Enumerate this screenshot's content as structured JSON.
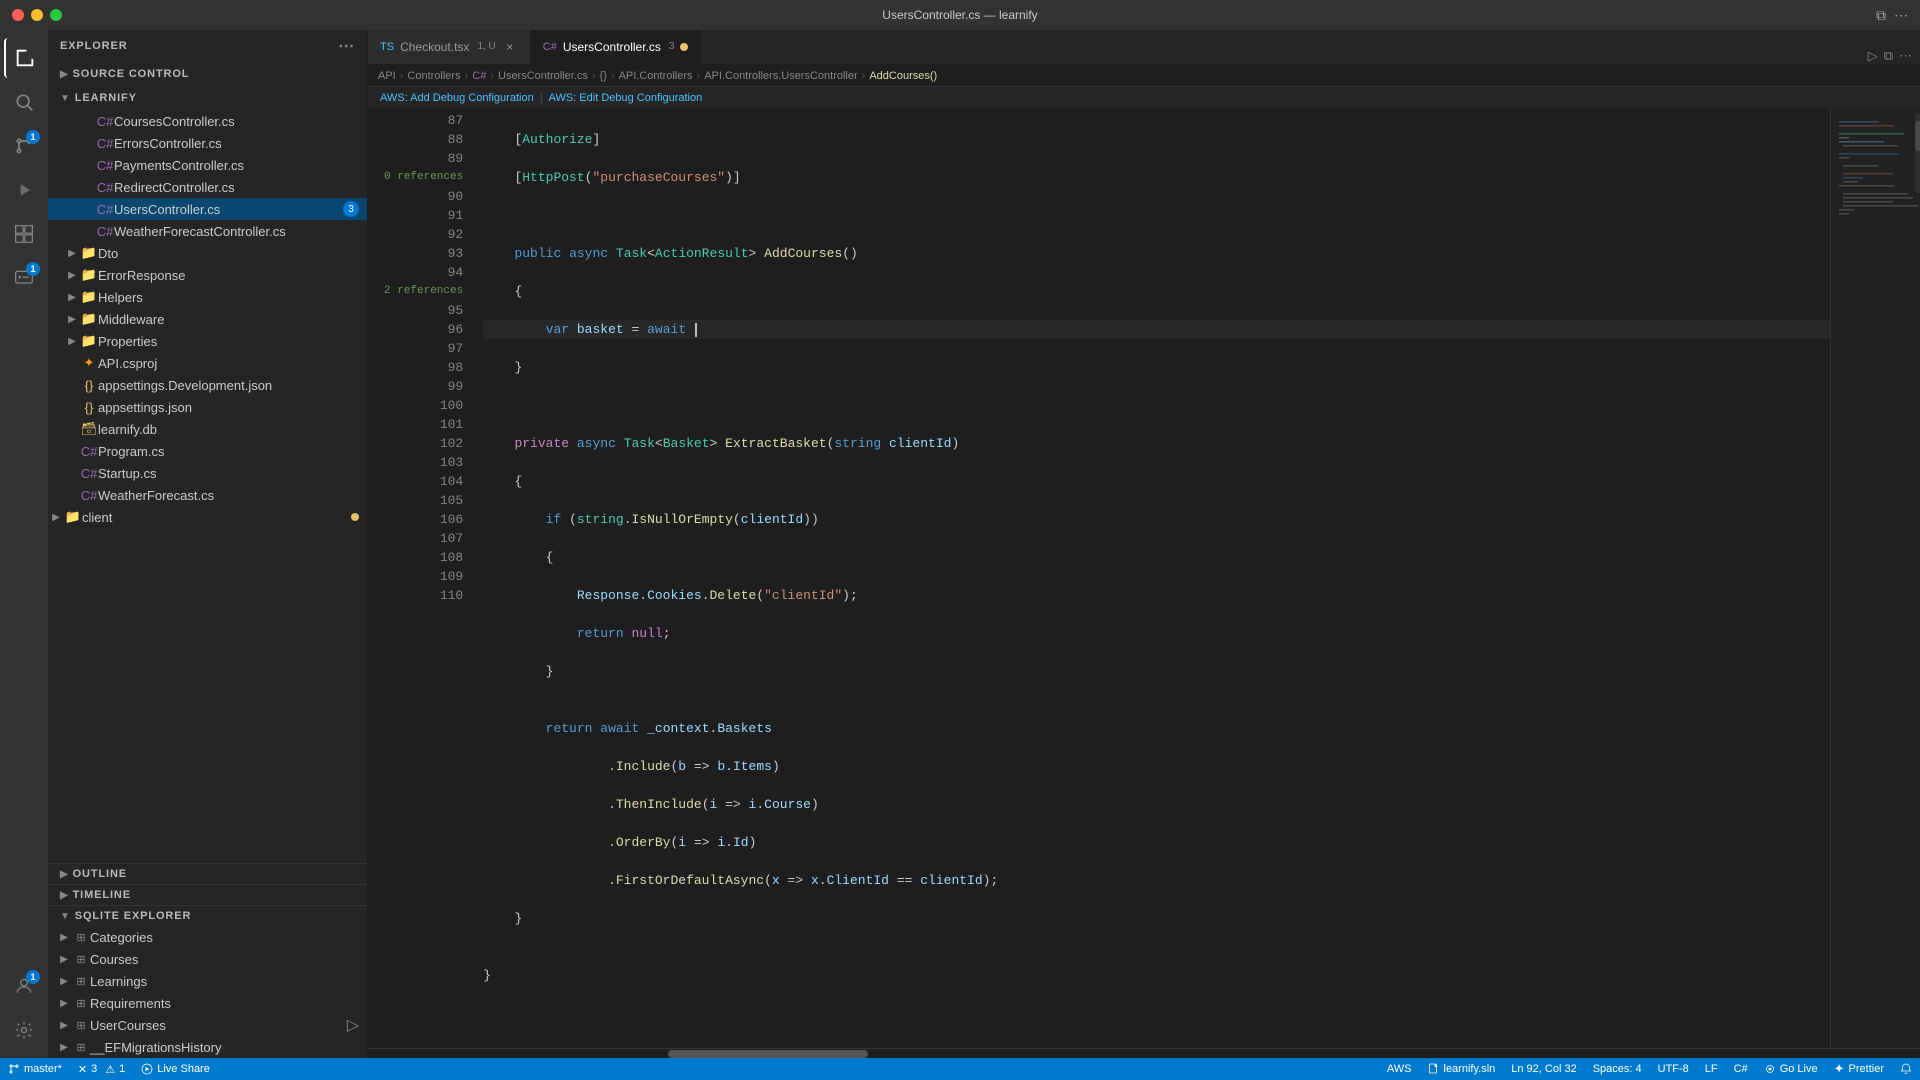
{
  "titleBar": {
    "title": "UsersController.cs — learnify",
    "trafficLights": [
      "red",
      "yellow",
      "green"
    ]
  },
  "tabs": [
    {
      "id": "checkout",
      "label": "Checkout.tsx",
      "badge": "1, U",
      "icon": "TS",
      "iconColor": "#4fc1ff",
      "active": false,
      "modified": false
    },
    {
      "id": "users",
      "label": "UsersController.cs",
      "badge": "3",
      "icon": "C#",
      "iconColor": "#9b6eaf",
      "active": true,
      "modified": true
    }
  ],
  "breadcrumb": {
    "items": [
      "API",
      "Controllers",
      "C#",
      "UsersController.cs",
      "{}",
      "API.Controllers",
      "API.Controllers.UsersController",
      "AddCourses()"
    ]
  },
  "awsBar": {
    "items": [
      "AWS: Add Debug Configuration",
      "AWS: Edit Debug Configuration"
    ]
  },
  "sidebar": {
    "explorerLabel": "EXPLORER",
    "sourceControlLabel": "SOURCE CONTROL",
    "projectName": "LEARNIFY",
    "files": [
      {
        "name": "CoursesController.cs",
        "type": "cs",
        "indent": 2
      },
      {
        "name": "ErrorsController.cs",
        "type": "cs",
        "indent": 2
      },
      {
        "name": "PaymentsController.cs",
        "type": "cs",
        "indent": 2
      },
      {
        "name": "RedirectController.cs",
        "type": "cs",
        "indent": 2
      },
      {
        "name": "UsersController.cs",
        "type": "cs",
        "indent": 2,
        "active": true,
        "badge": "3"
      },
      {
        "name": "WeatherForecastController.cs",
        "type": "cs",
        "indent": 2
      },
      {
        "name": "Dto",
        "type": "folder",
        "indent": 1
      },
      {
        "name": "ErrorResponse",
        "type": "folder",
        "indent": 1
      },
      {
        "name": "Helpers",
        "type": "folder",
        "indent": 1
      },
      {
        "name": "Middleware",
        "type": "folder",
        "indent": 1
      },
      {
        "name": "Properties",
        "type": "folder",
        "indent": 1
      },
      {
        "name": "API.csproj",
        "type": "proj",
        "indent": 1
      },
      {
        "name": "appsettings.Development.json",
        "type": "json",
        "indent": 1
      },
      {
        "name": "appsettings.json",
        "type": "json",
        "indent": 1
      },
      {
        "name": "learnify.db",
        "type": "db",
        "indent": 1
      },
      {
        "name": "Program.cs",
        "type": "cs",
        "indent": 1
      },
      {
        "name": "Startup.cs",
        "type": "cs",
        "indent": 1
      },
      {
        "name": "WeatherForecast.cs",
        "type": "cs",
        "indent": 1
      },
      {
        "name": "client",
        "type": "folder",
        "indent": 0,
        "dot": true
      }
    ],
    "outlineLabel": "OUTLINE",
    "timelineLabel": "TIMELINE",
    "sqliteLabel": "SQLITE EXPLORER",
    "sqliteTables": [
      "Categories",
      "Courses",
      "Learnings",
      "Requirements",
      "UserCourses",
      "__EFMigrationsHistory"
    ]
  },
  "editor": {
    "lines": [
      {
        "num": 87,
        "content": "    [Authorize]",
        "type": "normal"
      },
      {
        "num": 88,
        "content": "    [HttpPost(\"purchaseCourses\")]",
        "type": "normal"
      },
      {
        "num": 89,
        "content": "",
        "type": "normal"
      },
      {
        "num": 90,
        "content": "    public async Task<ActionResult> AddCourses()",
        "type": "normal"
      },
      {
        "num": 91,
        "content": "    {",
        "type": "normal"
      },
      {
        "num": 92,
        "content": "        var basket = await |",
        "type": "cursor"
      },
      {
        "num": 93,
        "content": "    }",
        "type": "normal"
      },
      {
        "num": 94,
        "content": "",
        "type": "normal"
      },
      {
        "num": 95,
        "content": "    private async Task<Basket> ExtractBasket(string clientId)",
        "type": "normal"
      },
      {
        "num": 96,
        "content": "    {",
        "type": "normal"
      },
      {
        "num": 97,
        "content": "        if (string.IsNullOrEmpty(clientId))",
        "type": "normal"
      },
      {
        "num": 98,
        "content": "        {",
        "type": "normal"
      },
      {
        "num": 99,
        "content": "            Response.Cookies.Delete(\"clientId\");",
        "type": "normal"
      },
      {
        "num": 100,
        "content": "            return null;",
        "type": "normal"
      },
      {
        "num": 101,
        "content": "        }",
        "type": "normal"
      },
      {
        "num": 102,
        "content": "",
        "type": "normal"
      },
      {
        "num": 103,
        "content": "        return await _context.Baskets",
        "type": "normal"
      },
      {
        "num": 104,
        "content": "                .Include(b => b.Items)",
        "type": "normal"
      },
      {
        "num": 105,
        "content": "                .ThenInclude(i => i.Course)",
        "type": "normal"
      },
      {
        "num": 106,
        "content": "                .OrderBy(i => i.Id)",
        "type": "normal"
      },
      {
        "num": 107,
        "content": "                .FirstOrDefaultAsync(x => x.ClientId == clientId);",
        "type": "normal"
      },
      {
        "num": 108,
        "content": "    }",
        "type": "normal"
      },
      {
        "num": 109,
        "content": "",
        "type": "normal"
      },
      {
        "num": 110,
        "content": "}",
        "type": "normal"
      }
    ],
    "refHints": {
      "90": "0 references",
      "95": "2 references"
    }
  },
  "statusBar": {
    "branch": "master*",
    "errors": "3",
    "warnings": "1",
    "liveshare": "Live Share",
    "aws": "AWS",
    "filename": "learnify.sln",
    "position": "Ln 92, Col 32",
    "spaces": "Spaces: 4",
    "encoding": "UTF-8",
    "lineEnding": "LF",
    "language": "C#",
    "goLive": "Go Live",
    "prettier": "Prettier"
  },
  "activityBar": {
    "icons": [
      "explorer",
      "search",
      "source-control",
      "run-debug",
      "extensions",
      "remote",
      "account",
      "settings"
    ]
  }
}
